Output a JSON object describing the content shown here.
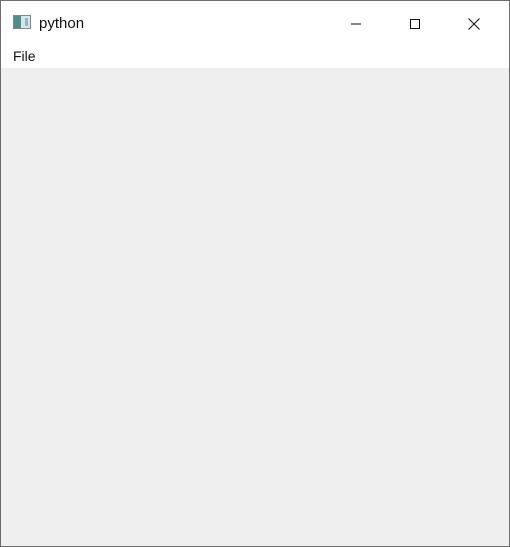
{
  "window": {
    "title": "python",
    "app_icon": "python-window-icon"
  },
  "title_controls": {
    "minimize_icon": "minimize-icon",
    "maximize_icon": "maximize-icon",
    "close_icon": "close-icon"
  },
  "menubar": {
    "items": [
      {
        "label": "File"
      }
    ]
  },
  "theme": {
    "client_background": "#efefef",
    "title_background": "#ffffff",
    "border": "#6e6e6e",
    "text": "#111111"
  }
}
